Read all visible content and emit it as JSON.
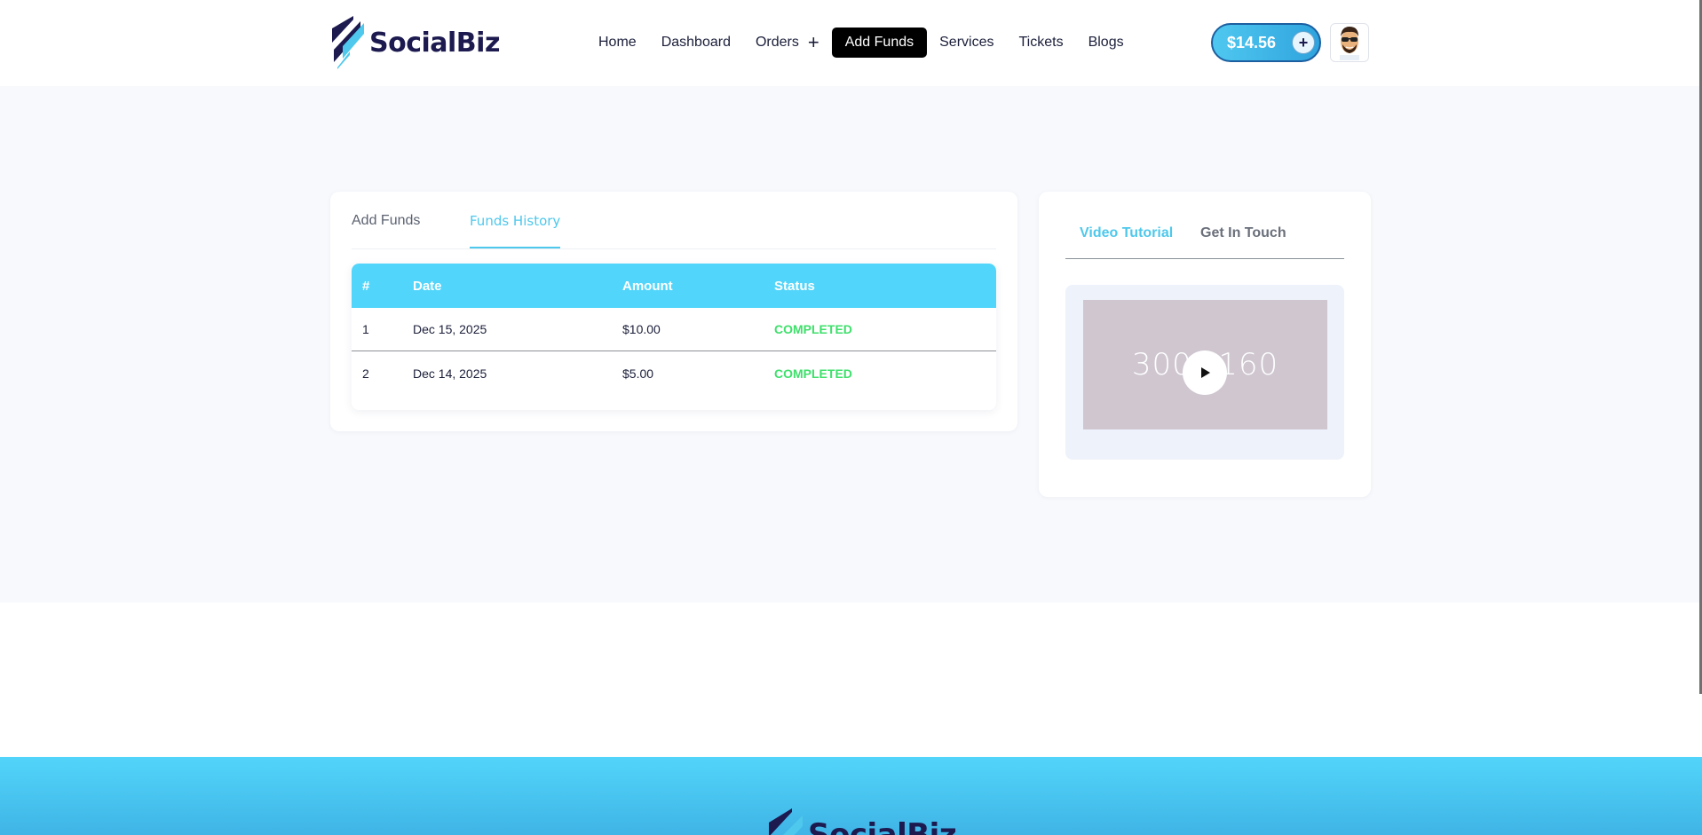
{
  "header": {
    "brand": "SocialBiz",
    "nav": [
      {
        "label": "Home"
      },
      {
        "label": "Dashboard"
      },
      {
        "label": "Orders"
      },
      {
        "label": "Add Funds"
      },
      {
        "label": "Services"
      },
      {
        "label": "Tickets"
      },
      {
        "label": "Blogs"
      }
    ],
    "orders_expand_icon": "plus-icon",
    "active_nav": "Add Funds",
    "balance": "$14.56",
    "balance_add_icon": "plus-icon",
    "avatar_icon": "avatar-icon"
  },
  "funds_card": {
    "tabs": [
      {
        "label": "Add Funds"
      },
      {
        "label": "Funds History"
      }
    ],
    "active_tab": "Funds History",
    "table": {
      "columns": [
        "#",
        "Date",
        "Amount",
        "Status"
      ],
      "rows": [
        {
          "index": "1",
          "date": "Dec 15, 2025",
          "amount": "$10.00",
          "status": "COMPLETED"
        },
        {
          "index": "2",
          "date": "Dec 14, 2025",
          "amount": "$5.00",
          "status": "COMPLETED"
        }
      ]
    }
  },
  "side_card": {
    "tabs": [
      {
        "label": "Video Tutorial"
      },
      {
        "label": "Get In Touch"
      }
    ],
    "active_tab": "Video Tutorial",
    "video_placeholder_text": "300×160",
    "play_icon": "play-icon"
  },
  "footer": {
    "brand": "SocialBiz"
  },
  "colors": {
    "accent": "#52d5fa",
    "status_completed": "#3ee06b",
    "brand_dark": "#1c1a4f"
  }
}
